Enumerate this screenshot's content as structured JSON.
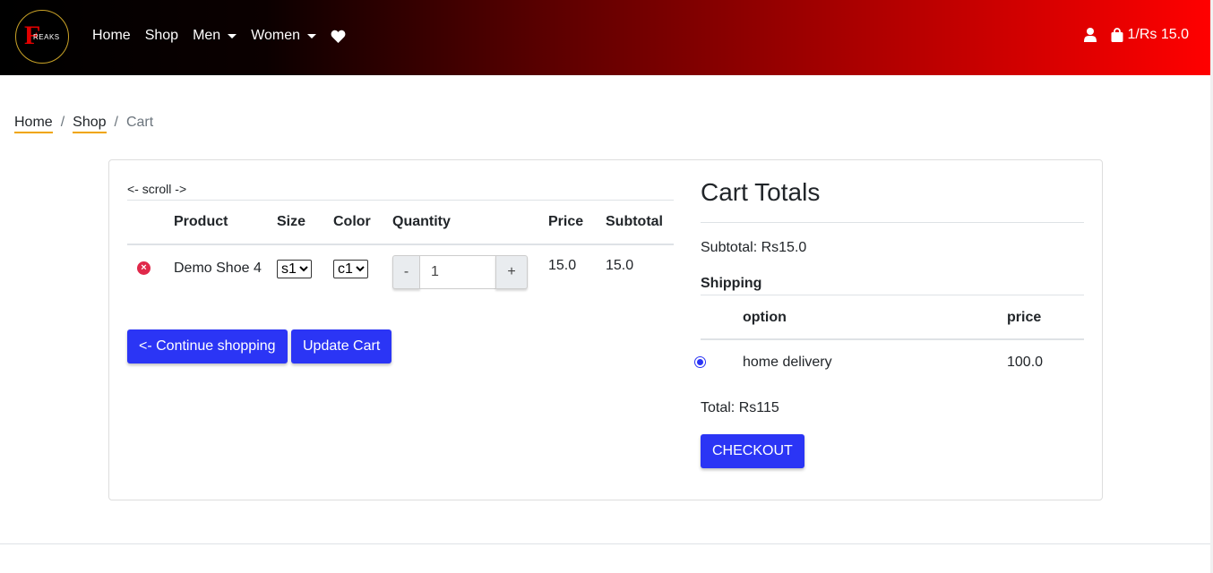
{
  "nav": {
    "logo_letter": "F",
    "logo_word": "REAKS",
    "links": [
      "Home",
      "Shop",
      "Men",
      "Women"
    ],
    "cart_summary": "1/Rs 15.0"
  },
  "breadcrumb": {
    "home": "Home",
    "shop": "Shop",
    "current": "Cart",
    "sep": "/"
  },
  "cart": {
    "scroll_hint": "<- scroll ->",
    "headers": {
      "product": "Product",
      "size": "Size",
      "color": "Color",
      "quantity": "Quantity",
      "price": "Price",
      "subtotal": "Subtotal"
    },
    "item": {
      "name": "Demo Shoe 4",
      "size": "s1",
      "color": "c1",
      "qty_minus": "-",
      "qty_value": "1",
      "qty_plus": "+",
      "price": "15.0",
      "subtotal": "15.0"
    },
    "continue_label": "<- Continue shopping",
    "update_label": "Update Cart"
  },
  "totals": {
    "title": "Cart Totals",
    "subtotal": "Subtotal: Rs15.0",
    "shipping_label": "Shipping",
    "option_header": "option",
    "price_header": "price",
    "option_name": "home delivery",
    "option_price": "100.0",
    "total": "Total: Rs115",
    "checkout_label": "CHECKOUT"
  },
  "colors": {
    "primary": "#2b35f5",
    "danger": "#e0284a",
    "accent": "#f0a500"
  }
}
